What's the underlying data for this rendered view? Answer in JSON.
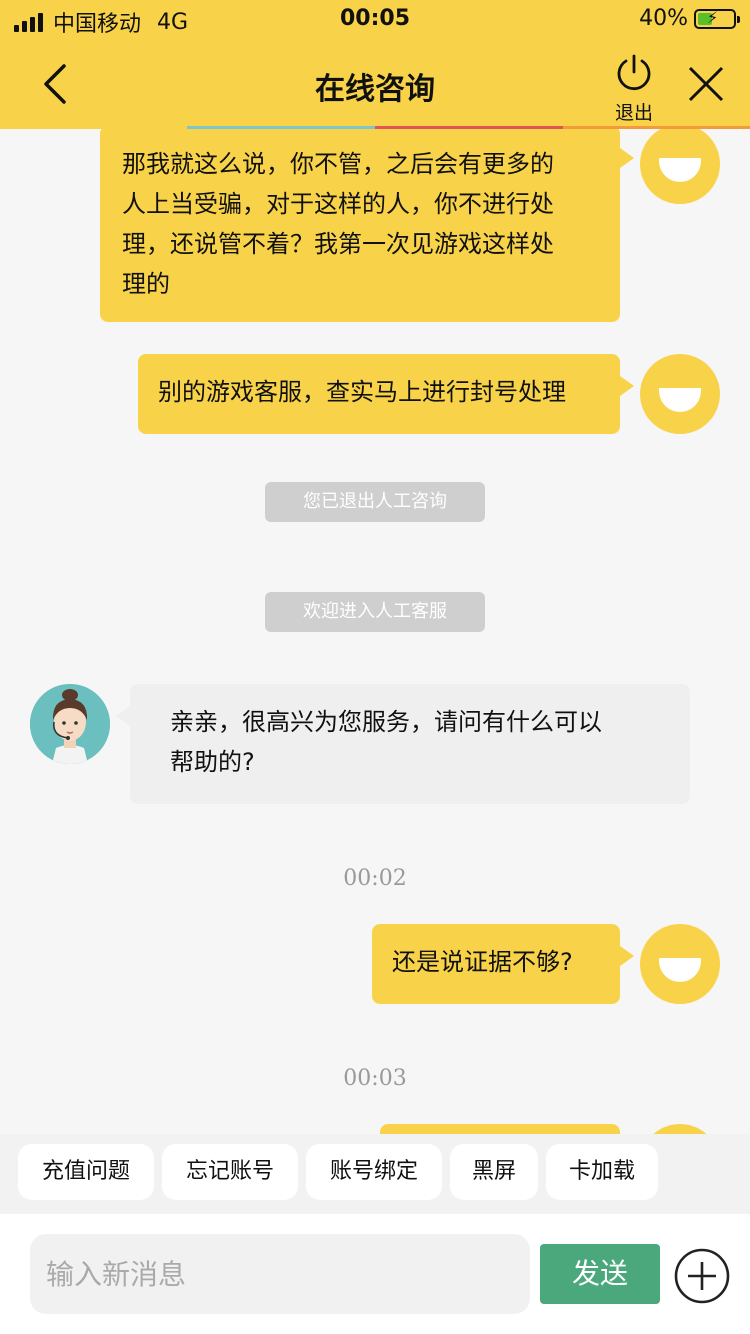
{
  "status_bar": {
    "carrier": "中国移动",
    "network": "4G",
    "time": "00:05",
    "battery": "40%",
    "battery_level": 0.4
  },
  "nav": {
    "title": "在线咨询",
    "exit_label": "退出"
  },
  "messages": {
    "m1": {
      "lines": [
        "那我就这么说，你不管，之后会有更多的",
        "人上当受骗，对于这样的人，你不进行处",
        "理，还说管不着？我第一次见游戏这样处",
        "理的"
      ]
    },
    "m2": {
      "text": "别的游戏客服，查实马上进行封号处理"
    },
    "sys1": "您已退出人工咨询",
    "sys2": "欢迎进入人工客服",
    "agent1": {
      "lines": [
        "亲亲，很高兴为您服务，请问有什么可以",
        "帮助的?"
      ]
    },
    "ts1": "00:02",
    "m3": {
      "text": "还是说证据不够?"
    },
    "ts2": "00:03"
  },
  "quick_replies": [
    "充值问题",
    "忘记账号",
    "账号绑定",
    "黑屏",
    "卡加载"
  ],
  "input": {
    "placeholder": "输入新消息",
    "send_label": "发送"
  },
  "colors": {
    "brand_yellow": "#f8d349",
    "send_green": "#4ba87d",
    "agent_bubble": "#efefef"
  }
}
